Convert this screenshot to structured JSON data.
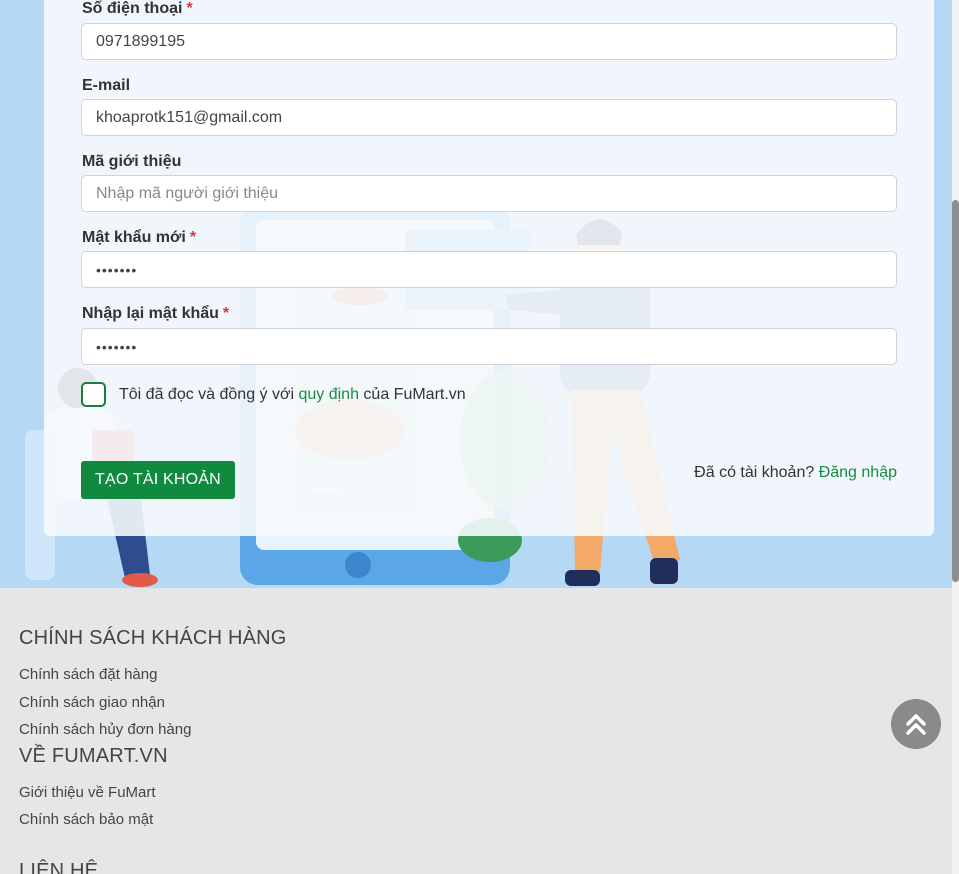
{
  "form": {
    "phone": {
      "label": "Số điện thoại",
      "required": "*",
      "value": "0971899195"
    },
    "email": {
      "label": "E-mail",
      "value": "khoaprotk151@gmail.com"
    },
    "referral": {
      "label": "Mã giới thiệu",
      "placeholder": "Nhập mã người giới thiệu"
    },
    "new_password": {
      "label": "Mật khẩu mới",
      "required": "*",
      "value": "•••••••"
    },
    "confirm_password": {
      "label": "Nhập lại mật khẩu",
      "required": "*",
      "value": "•••••••"
    },
    "agree": {
      "prefix": "Tôi đã đọc và đồng ý với ",
      "link": "quy định",
      "suffix": " của FuMart.vn"
    },
    "create_button": "TẠO TÀI KHOẢN",
    "login_prompt": "Đã có tài khoản? ",
    "login_link": "Đăng nhập"
  },
  "footer": {
    "customer_policy": {
      "heading": "CHÍNH SÁCH KHÁCH HÀNG",
      "links": [
        "Chính sách đặt hàng",
        "Chính sách giao nhận",
        "Chính sách hủy đơn hàng"
      ]
    },
    "about": {
      "heading": "VỀ FUMART.VN",
      "links": [
        "Giới thiệu về FuMart",
        "Chính sách bảo mật"
      ]
    },
    "contact": {
      "heading": "LIÊN HỆ"
    }
  },
  "colors": {
    "primary": "#0f8a3e",
    "link": "#1a8a45",
    "required": "#d9363e",
    "hero_bg": "#b5d8f5",
    "footer_bg": "#e6e6e6"
  },
  "icons": {
    "back_to_top": "double-chevron-up-icon"
  }
}
